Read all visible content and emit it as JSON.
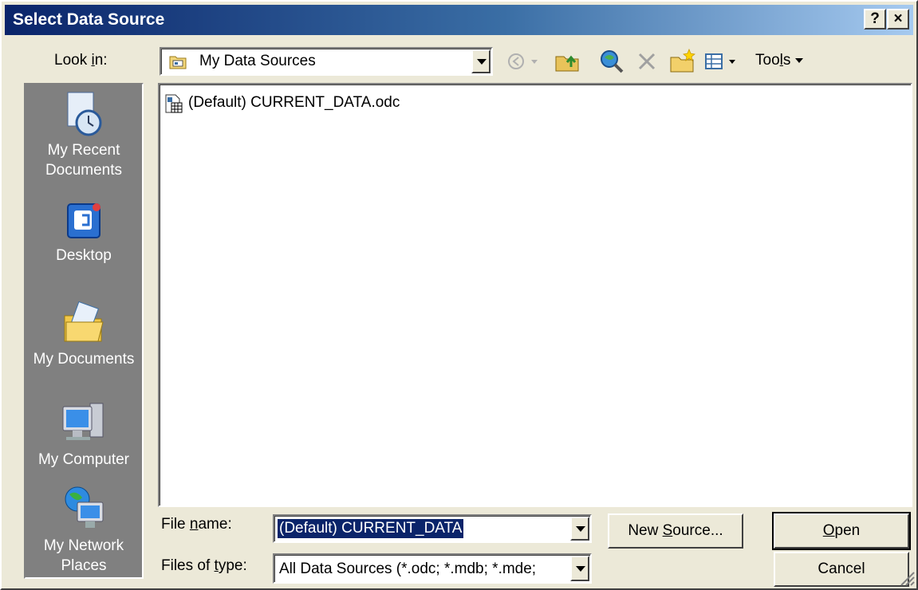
{
  "titlebar": {
    "title": "Select Data Source",
    "help_label": "?",
    "close_label": "×"
  },
  "lookin": {
    "label_pre": "Look ",
    "label_u": "i",
    "label_post": "n:",
    "value": "My Data Sources",
    "icon": "folder-icon"
  },
  "toolbar": {
    "tools_pre": "Too",
    "tools_u": "l",
    "tools_post": "s",
    "icons": [
      "back-icon",
      "up-folder-icon",
      "search-web-icon",
      "delete-icon",
      "new-folder-icon",
      "views-icon"
    ]
  },
  "places": [
    {
      "label": "My Recent Documents",
      "line1": "My Recent",
      "line2": "Documents",
      "icon": "recent-documents-icon"
    },
    {
      "label": "Desktop",
      "line1": "Desktop",
      "line2": "",
      "icon": "desktop-icon"
    },
    {
      "label": "My Documents",
      "line1": "My Documents",
      "line2": "",
      "icon": "my-documents-icon"
    },
    {
      "label": "My Computer",
      "line1": "My Computer",
      "line2": "",
      "icon": "my-computer-icon"
    },
    {
      "label": "My Network Places",
      "line1": "My Network",
      "line2": "Places",
      "icon": "network-places-icon"
    }
  ],
  "files": [
    {
      "name": "(Default) CURRENT_DATA.odc",
      "icon": "odc-file-icon"
    }
  ],
  "filename": {
    "label_pre": "File ",
    "label_u": "n",
    "label_post": "ame:",
    "value": "(Default) CURRENT_DATA"
  },
  "filetype": {
    "label_pre": "Files of ",
    "label_u": "t",
    "label_post": "ype:",
    "value": "All Data Sources (*.odc; *.mdb; *.mde;"
  },
  "buttons": {
    "new_source_pre": "New ",
    "new_source_u": "S",
    "new_source_post": "ource...",
    "open_u": "O",
    "open_post": "pen",
    "cancel": "Cancel"
  },
  "colors": {
    "title_start": "#0a246a",
    "title_end": "#a6caf0",
    "places_bg": "#808080",
    "face": "#ece9d8",
    "selection": "#0a246a"
  }
}
